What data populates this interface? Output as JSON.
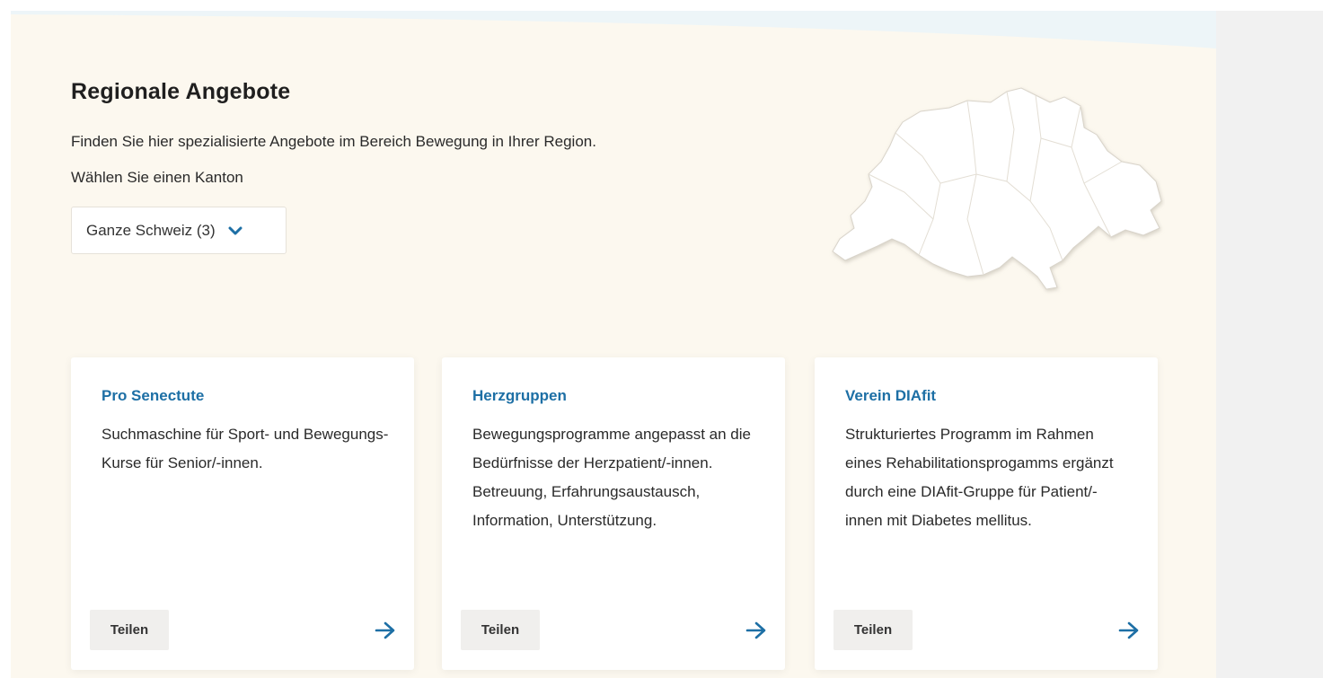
{
  "section": {
    "title": "Regionale Angebote",
    "intro": "Finden Sie hier spezialisierte Angebote im Bereich Bewegung in Ihrer Region.",
    "kanton_label": "Wählen Sie einen Kanton",
    "kanton_select": {
      "value": "Ganze Schweiz (3)",
      "icon": "chevron-down-icon"
    },
    "map_icon": "switzerland-map"
  },
  "cards": [
    {
      "title": "Pro Senectute",
      "text": "Suchmaschine für Sport- und Bewegungs-Kurse für Senior/-innen.",
      "share_label": "Teilen",
      "arrow_icon": "arrow-right-icon"
    },
    {
      "title": "Herzgruppen",
      "text": "Bewegungsprogramme angepasst an die Bedürfnisse der Herzpatient/-innen. Betreuung, Erfahrungsaustausch, Information, Unterstützung.",
      "share_label": "Teilen",
      "arrow_icon": "arrow-right-icon"
    },
    {
      "title": "Verein DIAfit",
      "text": "Strukturiertes Programm im Rahmen eines Rehabilitationsprogamms ergänzt durch eine DIAfit-Gruppe für Patient/-innen mit Diabetes mellitus.",
      "share_label": "Teilen",
      "arrow_icon": "arrow-right-icon"
    }
  ],
  "colors": {
    "section_bg": "#fcf8ef",
    "accent": "#1d6fa5",
    "card_bg": "#ffffff",
    "button_bg": "#f0efed"
  }
}
